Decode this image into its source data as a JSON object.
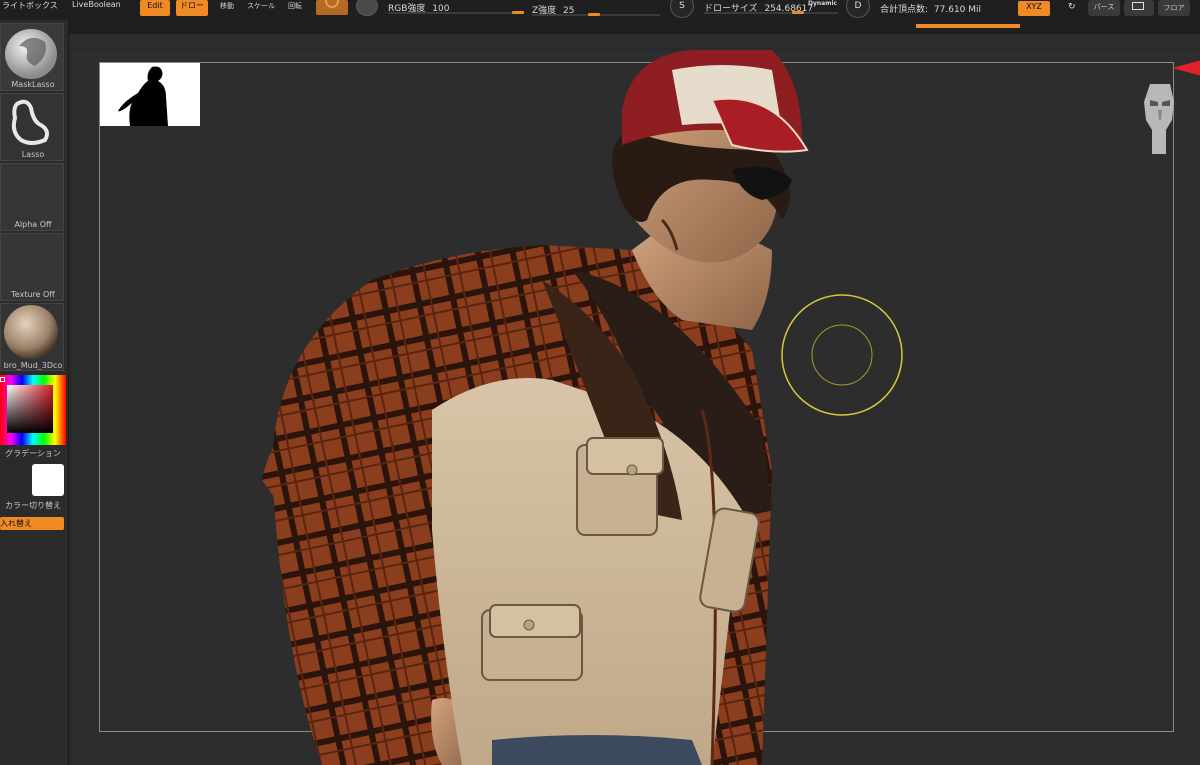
{
  "topbar": {
    "left_title_1": "ライトボックス",
    "left_title_2": "LiveBoolean",
    "edit_label": "Edit",
    "draw_label": "ドロー",
    "move_label": "移動",
    "scale_label": "スケール",
    "rotate_label": "回転",
    "rgb_label": "RGB強度",
    "rgb_value": "100",
    "z_label": "Z強度",
    "z_value": "25",
    "s_label": "S",
    "draw_size_label": "ドローサイズ",
    "draw_size_value": "254.68617",
    "dynamic_label": "Dynamic",
    "d_label": "D",
    "total_vertices_label": "合計頂点数:",
    "total_vertices_value": "77.610 Mil",
    "xyz_label": "XYZ",
    "perspective_label": "パース",
    "floor_label": "フロア"
  },
  "leftpanel": {
    "brush1_label": "MaskLasso",
    "brush2_label": "Lasso",
    "alpha_label": "Alpha Off",
    "texture_label": "Texture Off",
    "material_label": "bro_Mud_3Dco",
    "gradient_label": "グラデーション",
    "color_switch_label": "カラー切り替え",
    "swap_label": "入れ替え"
  },
  "colors": {
    "accent": "#f08a24",
    "panel": "#2b2b2b",
    "canvas": "#2d2d2d",
    "cursor_ring": "#d6c83a"
  }
}
